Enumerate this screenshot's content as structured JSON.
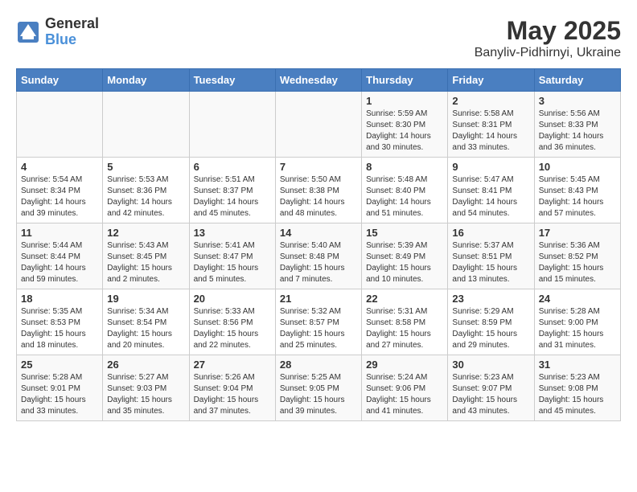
{
  "logo": {
    "line1": "General",
    "line2": "Blue"
  },
  "title": "May 2025",
  "subtitle": "Banyliv-Pidhirnyi, Ukraine",
  "days_of_week": [
    "Sunday",
    "Monday",
    "Tuesday",
    "Wednesday",
    "Thursday",
    "Friday",
    "Saturday"
  ],
  "weeks": [
    [
      {
        "day": "",
        "info": ""
      },
      {
        "day": "",
        "info": ""
      },
      {
        "day": "",
        "info": ""
      },
      {
        "day": "",
        "info": ""
      },
      {
        "day": "1",
        "info": "Sunrise: 5:59 AM\nSunset: 8:30 PM\nDaylight: 14 hours\nand 30 minutes."
      },
      {
        "day": "2",
        "info": "Sunrise: 5:58 AM\nSunset: 8:31 PM\nDaylight: 14 hours\nand 33 minutes."
      },
      {
        "day": "3",
        "info": "Sunrise: 5:56 AM\nSunset: 8:33 PM\nDaylight: 14 hours\nand 36 minutes."
      }
    ],
    [
      {
        "day": "4",
        "info": "Sunrise: 5:54 AM\nSunset: 8:34 PM\nDaylight: 14 hours\nand 39 minutes."
      },
      {
        "day": "5",
        "info": "Sunrise: 5:53 AM\nSunset: 8:36 PM\nDaylight: 14 hours\nand 42 minutes."
      },
      {
        "day": "6",
        "info": "Sunrise: 5:51 AM\nSunset: 8:37 PM\nDaylight: 14 hours\nand 45 minutes."
      },
      {
        "day": "7",
        "info": "Sunrise: 5:50 AM\nSunset: 8:38 PM\nDaylight: 14 hours\nand 48 minutes."
      },
      {
        "day": "8",
        "info": "Sunrise: 5:48 AM\nSunset: 8:40 PM\nDaylight: 14 hours\nand 51 minutes."
      },
      {
        "day": "9",
        "info": "Sunrise: 5:47 AM\nSunset: 8:41 PM\nDaylight: 14 hours\nand 54 minutes."
      },
      {
        "day": "10",
        "info": "Sunrise: 5:45 AM\nSunset: 8:43 PM\nDaylight: 14 hours\nand 57 minutes."
      }
    ],
    [
      {
        "day": "11",
        "info": "Sunrise: 5:44 AM\nSunset: 8:44 PM\nDaylight: 14 hours\nand 59 minutes."
      },
      {
        "day": "12",
        "info": "Sunrise: 5:43 AM\nSunset: 8:45 PM\nDaylight: 15 hours\nand 2 minutes."
      },
      {
        "day": "13",
        "info": "Sunrise: 5:41 AM\nSunset: 8:47 PM\nDaylight: 15 hours\nand 5 minutes."
      },
      {
        "day": "14",
        "info": "Sunrise: 5:40 AM\nSunset: 8:48 PM\nDaylight: 15 hours\nand 7 minutes."
      },
      {
        "day": "15",
        "info": "Sunrise: 5:39 AM\nSunset: 8:49 PM\nDaylight: 15 hours\nand 10 minutes."
      },
      {
        "day": "16",
        "info": "Sunrise: 5:37 AM\nSunset: 8:51 PM\nDaylight: 15 hours\nand 13 minutes."
      },
      {
        "day": "17",
        "info": "Sunrise: 5:36 AM\nSunset: 8:52 PM\nDaylight: 15 hours\nand 15 minutes."
      }
    ],
    [
      {
        "day": "18",
        "info": "Sunrise: 5:35 AM\nSunset: 8:53 PM\nDaylight: 15 hours\nand 18 minutes."
      },
      {
        "day": "19",
        "info": "Sunrise: 5:34 AM\nSunset: 8:54 PM\nDaylight: 15 hours\nand 20 minutes."
      },
      {
        "day": "20",
        "info": "Sunrise: 5:33 AM\nSunset: 8:56 PM\nDaylight: 15 hours\nand 22 minutes."
      },
      {
        "day": "21",
        "info": "Sunrise: 5:32 AM\nSunset: 8:57 PM\nDaylight: 15 hours\nand 25 minutes."
      },
      {
        "day": "22",
        "info": "Sunrise: 5:31 AM\nSunset: 8:58 PM\nDaylight: 15 hours\nand 27 minutes."
      },
      {
        "day": "23",
        "info": "Sunrise: 5:29 AM\nSunset: 8:59 PM\nDaylight: 15 hours\nand 29 minutes."
      },
      {
        "day": "24",
        "info": "Sunrise: 5:28 AM\nSunset: 9:00 PM\nDaylight: 15 hours\nand 31 minutes."
      }
    ],
    [
      {
        "day": "25",
        "info": "Sunrise: 5:28 AM\nSunset: 9:01 PM\nDaylight: 15 hours\nand 33 minutes."
      },
      {
        "day": "26",
        "info": "Sunrise: 5:27 AM\nSunset: 9:03 PM\nDaylight: 15 hours\nand 35 minutes."
      },
      {
        "day": "27",
        "info": "Sunrise: 5:26 AM\nSunset: 9:04 PM\nDaylight: 15 hours\nand 37 minutes."
      },
      {
        "day": "28",
        "info": "Sunrise: 5:25 AM\nSunset: 9:05 PM\nDaylight: 15 hours\nand 39 minutes."
      },
      {
        "day": "29",
        "info": "Sunrise: 5:24 AM\nSunset: 9:06 PM\nDaylight: 15 hours\nand 41 minutes."
      },
      {
        "day": "30",
        "info": "Sunrise: 5:23 AM\nSunset: 9:07 PM\nDaylight: 15 hours\nand 43 minutes."
      },
      {
        "day": "31",
        "info": "Sunrise: 5:23 AM\nSunset: 9:08 PM\nDaylight: 15 hours\nand 45 minutes."
      }
    ]
  ]
}
